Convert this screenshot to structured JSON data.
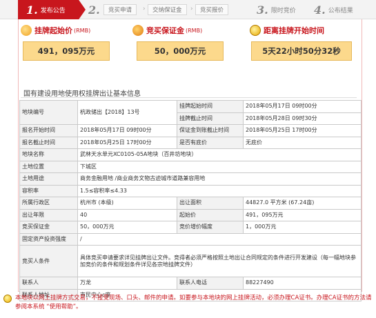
{
  "steps": {
    "s1_num": "1.",
    "s1_label": "发布公告",
    "s2_num": "2.",
    "s2_sub1": "竞买申请",
    "s2_sub2": "交纳保证金",
    "s2_sub3": "竞买报价",
    "s3_num": "3.",
    "s3_label": "限时竞价",
    "s4_num": "4.",
    "s4_label": "公布结果"
  },
  "cards": {
    "start_price_title": "挂牌起始价",
    "start_price_unit": "(RMB)",
    "start_price_value": "491，095万元",
    "deposit_title": "竞买保证金",
    "deposit_unit": "(RMB)",
    "deposit_value": "50，000万元",
    "countdown_title": "距离挂牌开始时间",
    "countdown_value": "5天22小时50分32秒"
  },
  "section_title": "国有建设用地使用权挂牌出让基本信息",
  "table": {
    "r1_k1": "地块编号",
    "r1_v1": "杭政储出【2018】13号",
    "r1_k2": "挂牌起始时间",
    "r1_v2": "2018年05月17日 09时00分",
    "r2_k2": "挂牌截止时间",
    "r2_v2": "2018年05月28日 09时30分",
    "r3_k1": "报名开始时间",
    "r3_v1": "2018年05月17日 09时00分",
    "r3_k2": "保证金到账截止时间",
    "r3_v2": "2018年05月25日 17时00分",
    "r4_k1": "报名截止时间",
    "r4_v1": "2018年05月25日 17时00分",
    "r4_k2": "是否有底价",
    "r4_v2": "无底价",
    "r5_k": "地块名称",
    "r5_v": "武林天水单元XC0105-05A地块（百井坊地块）",
    "r6_k": "土地位置",
    "r6_v": "下城区",
    "r7_k": "土地用途",
    "r7_v": "商务金融用地 /商业商务文物古迹城市道路兼容用地",
    "r8_k": "容积率",
    "r8_v": "1.5≤容积率≤4.33",
    "r9_k1": "所属行政区",
    "r9_v1": "杭州市 (本级)",
    "r9_k2": "出让面积",
    "r9_v2": "44827.0 平方米 (67.24亩)",
    "r10_k1": "出让年限",
    "r10_v1": "40",
    "r10_k2": "起始价",
    "r10_v2": "491，095万元",
    "r11_k1": "竞买保证金",
    "r11_v1": "50，000万元",
    "r11_k2": "竞价增价幅度",
    "r11_v2": "1，000万元",
    "r12_k": "固定资产投资强度",
    "r12_v": "/",
    "r13_k": "竞买人条件",
    "r13_v": "具体竞买申请要求详见挂牌出让文件。竞得者必须严格按照土地出让合同规定的条件进行开发建设（每一幅地块参加竞价的条件和规划条件详见各宗地挂牌文件）",
    "r14_k1": "联系人",
    "r14_v1": "万龙",
    "r14_k2": "联系人电话",
    "r14_v2": "88227490",
    "r15_k": "联系人地址",
    "r15_v": "市民中心c座"
  },
  "notice": "本地块以网上挂牌方式交易，不接受现场、口头、邮件的申请。如要参与本地块的网上挂牌活动，必须办理CA证书。办理CA证书的方法请参阅本系统 “使用帮助”。",
  "colors": {
    "accent": "#c8161d",
    "value_box": "#fcd98c"
  }
}
